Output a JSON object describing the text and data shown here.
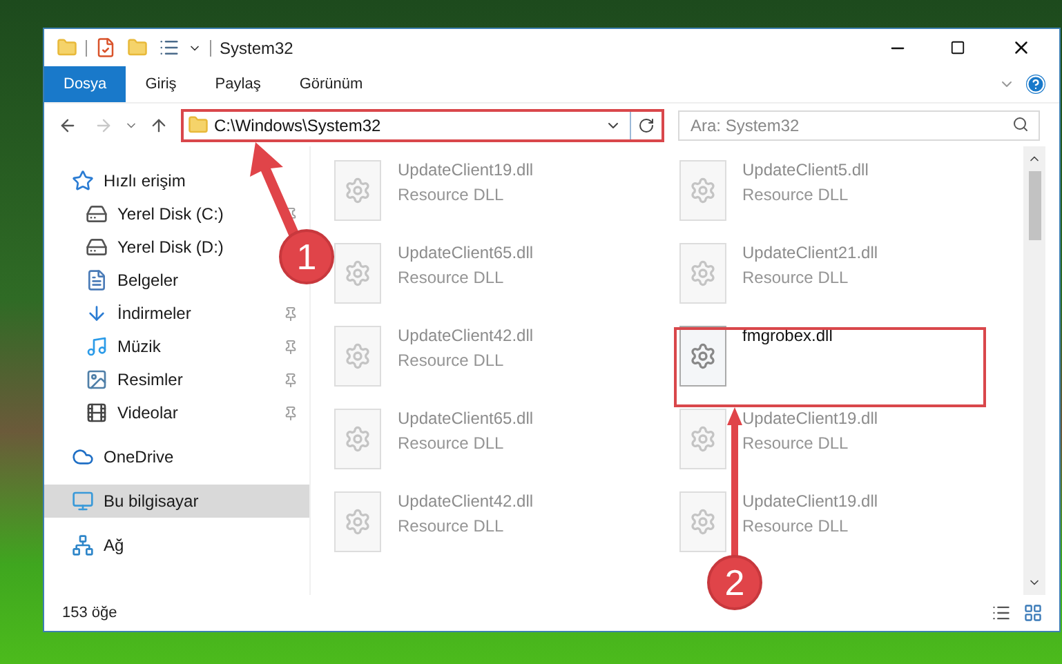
{
  "window": {
    "title": "System32"
  },
  "ribbon_tabs": [
    {
      "label": "Dosya",
      "selected": true
    },
    {
      "label": "Giriş",
      "selected": false
    },
    {
      "label": "Paylaş",
      "selected": false
    },
    {
      "label": "Görünüm",
      "selected": false
    }
  ],
  "address": {
    "path": "C:\\Windows\\System32"
  },
  "search": {
    "placeholder": "Ara: System32"
  },
  "sidebar": {
    "items": [
      {
        "label": "Hızlı erişim",
        "kind": "star",
        "selected": false,
        "children": [
          {
            "label": "Yerel Disk (C:)",
            "kind": "drive",
            "pinned": true,
            "selected": false
          },
          {
            "label": "Yerel Disk (D:)",
            "kind": "drive",
            "pinned": false,
            "selected": false
          },
          {
            "label": "Belgeler",
            "kind": "documents",
            "pinned": false,
            "selected": false
          },
          {
            "label": "İndirmeler",
            "kind": "downloads",
            "pinned": true,
            "selected": false
          },
          {
            "label": "Müzik",
            "kind": "music",
            "pinned": true,
            "selected": false
          },
          {
            "label": "Resimler",
            "kind": "pictures",
            "pinned": true,
            "selected": false
          },
          {
            "label": "Videolar",
            "kind": "videos",
            "pinned": true,
            "selected": false
          }
        ]
      },
      {
        "label": "OneDrive",
        "kind": "cloud",
        "selected": false
      },
      {
        "label": "Bu bilgisayar",
        "kind": "computer",
        "selected": true
      },
      {
        "label": "Ağ",
        "kind": "network",
        "selected": false
      }
    ]
  },
  "files": [
    {
      "name": "UpdateClient19.dll",
      "type": "Resource DLL",
      "blurred": true
    },
    {
      "name": "UpdateClient5.dll",
      "type": "Resource DLL",
      "blurred": true
    },
    {
      "name": "UpdateClient65.dll",
      "type": "Resource DLL",
      "blurred": true
    },
    {
      "name": "UpdateClient21.dll",
      "type": "Resource DLL",
      "blurred": true
    },
    {
      "name": "UpdateClient42.dll",
      "type": "Resource DLL",
      "blurred": true
    },
    {
      "name": "fmgrobex.dll",
      "blurred": false
    },
    {
      "name": "UpdateClient65.dll",
      "type": "Resource DLL",
      "blurred": true
    },
    {
      "name": "UpdateClient19.dll",
      "type": "Resource DLL",
      "blurred": true
    },
    {
      "name": "UpdateClient42.dll",
      "type": "Resource DLL",
      "blurred": true
    },
    {
      "name": "UpdateClient19.dll",
      "type": "Resource DLL",
      "blurred": true
    }
  ],
  "status_bar": {
    "item_count": "153 öğe"
  },
  "callouts": [
    {
      "number": "1"
    },
    {
      "number": "2"
    }
  ]
}
